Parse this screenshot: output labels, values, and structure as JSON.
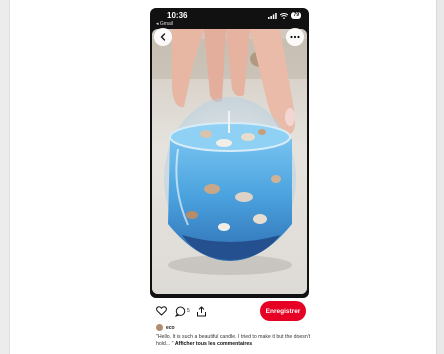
{
  "status_bar": {
    "time": "10:36",
    "back_app": "◂ Gmail",
    "battery": "79"
  },
  "pin": {
    "image_alt": "Ocean candle in glass bowl with seashells",
    "actions": {
      "comment_count": "5",
      "save_label": "Enregistrer"
    },
    "author": {
      "name": "eco"
    },
    "comment": {
      "text": "\"Hello. It is such a beautiful candle. I tried to make it but the doesn't hold... \"",
      "see_all": "Afficher tous les commentaires"
    }
  },
  "colors": {
    "accent": "#e60023",
    "water": "#5ab0e6"
  }
}
